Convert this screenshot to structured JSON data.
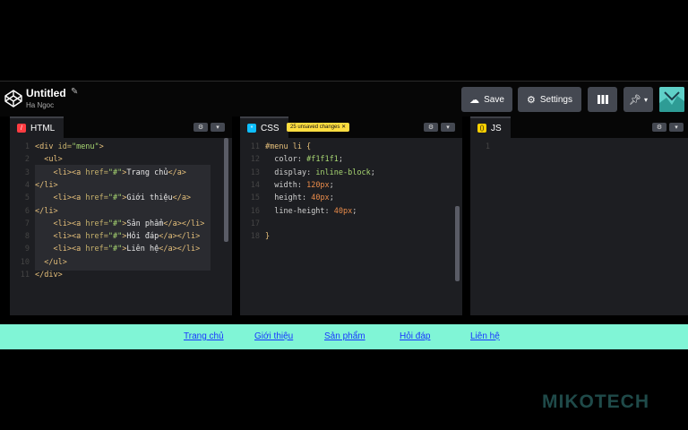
{
  "header": {
    "title": "Untitled",
    "author": "Ha Ngoc",
    "save_label": "Save",
    "settings_label": "Settings",
    "icons": [
      "codepen-logo-icon",
      "pencil-icon",
      "cloud-icon",
      "gear-icon",
      "layout-icon",
      "pin-icon",
      "chevron-down-icon"
    ]
  },
  "editors": {
    "html": {
      "tab_label": "HTML",
      "badge_color": "#ff3c41",
      "lines": [
        {
          "n": "1",
          "parts": [
            [
              "tag",
              "<div "
            ],
            [
              "attr",
              "id="
            ],
            [
              "str",
              "\"menu\""
            ],
            [
              "tag",
              ">"
            ]
          ]
        },
        {
          "n": "2",
          "parts": [
            [
              "txt",
              "  "
            ],
            [
              "tag",
              "<ul>"
            ]
          ]
        },
        {
          "n": "3",
          "parts": [
            [
              "txt",
              "    "
            ],
            [
              "tag",
              "<li><a "
            ],
            [
              "attr",
              "href="
            ],
            [
              "str",
              "\"#\""
            ],
            [
              "tag",
              ">"
            ],
            [
              "txt",
              "Trang chủ"
            ],
            [
              "tag",
              "</a>"
            ]
          ]
        },
        {
          "n": "4",
          "parts": [
            [
              "tag",
              "</li>"
            ]
          ]
        },
        {
          "n": "5",
          "parts": [
            [
              "txt",
              "    "
            ],
            [
              "tag",
              "<li><a "
            ],
            [
              "attr",
              "href="
            ],
            [
              "str",
              "\"#\""
            ],
            [
              "tag",
              ">"
            ],
            [
              "txt",
              "Giới thiệu"
            ],
            [
              "tag",
              "</a>"
            ]
          ]
        },
        {
          "n": "6",
          "parts": [
            [
              "tag",
              "</li>"
            ]
          ]
        },
        {
          "n": "7",
          "parts": [
            [
              "txt",
              "    "
            ],
            [
              "tag",
              "<li><a "
            ],
            [
              "attr",
              "href="
            ],
            [
              "str",
              "\"#\""
            ],
            [
              "tag",
              ">"
            ],
            [
              "txt",
              "Sản phẩm"
            ],
            [
              "tag",
              "</a></li>"
            ]
          ]
        },
        {
          "n": "8",
          "parts": [
            [
              "txt",
              "    "
            ],
            [
              "tag",
              "<li><a "
            ],
            [
              "attr",
              "href="
            ],
            [
              "str",
              "\"#\""
            ],
            [
              "tag",
              ">"
            ],
            [
              "txt",
              "Hỏi đáp"
            ],
            [
              "tag",
              "</a></li>"
            ]
          ]
        },
        {
          "n": "9",
          "parts": [
            [
              "txt",
              "    "
            ],
            [
              "tag",
              "<li><a "
            ],
            [
              "attr",
              "href="
            ],
            [
              "str",
              "\"#\""
            ],
            [
              "tag",
              ">"
            ],
            [
              "txt",
              "Liên hệ"
            ],
            [
              "tag",
              "</a></li>"
            ]
          ]
        },
        {
          "n": "10",
          "parts": [
            [
              "txt",
              "  "
            ],
            [
              "tag",
              "</ul>"
            ]
          ]
        },
        {
          "n": "11",
          "parts": [
            [
              "tag",
              "</div>"
            ]
          ]
        }
      ]
    },
    "css": {
      "tab_label": "CSS",
      "badge_color": "#0ebeff",
      "unsaved_label": "25 unsaved changes",
      "lines": [
        {
          "n": "11",
          "parts": [
            [
              "sel",
              "#menu li {"
            ]
          ]
        },
        {
          "n": "12",
          "parts": [
            [
              "txt",
              "  "
            ],
            [
              "prop",
              "color: "
            ],
            [
              "val",
              "#f1f1f1"
            ],
            [
              "prop",
              ";"
            ]
          ]
        },
        {
          "n": "13",
          "parts": [
            [
              "txt",
              "  "
            ],
            [
              "prop",
              "display: "
            ],
            [
              "val",
              "inline-block"
            ],
            [
              "prop",
              ";"
            ]
          ]
        },
        {
          "n": "14",
          "parts": [
            [
              "txt",
              "  "
            ],
            [
              "prop",
              "width: "
            ],
            [
              "num",
              "120px"
            ],
            [
              "prop",
              ";"
            ]
          ]
        },
        {
          "n": "15",
          "parts": [
            [
              "txt",
              "  "
            ],
            [
              "prop",
              "height: "
            ],
            [
              "num",
              "40px"
            ],
            [
              "prop",
              ";"
            ]
          ]
        },
        {
          "n": "16",
          "parts": [
            [
              "txt",
              "  "
            ],
            [
              "prop",
              "line-height: "
            ],
            [
              "num",
              "40px"
            ],
            [
              "prop",
              ";"
            ]
          ]
        },
        {
          "n": "17",
          "parts": []
        },
        {
          "n": "18",
          "parts": [
            [
              "sel",
              "}"
            ]
          ]
        }
      ]
    },
    "js": {
      "tab_label": "JS",
      "badge_color": "#fcd000",
      "lines": [
        {
          "n": "1",
          "parts": []
        }
      ]
    }
  },
  "preview": {
    "links": [
      "Trang chủ",
      "Giới thiệu",
      "Sản phẩm",
      "Hỏi đáp",
      "Liên hệ"
    ]
  },
  "watermark": "MIKOTECH"
}
